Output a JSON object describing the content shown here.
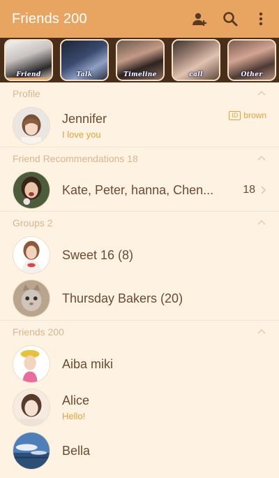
{
  "header": {
    "title": "Friends 200",
    "icons": [
      "add-friend-icon",
      "search-icon",
      "more-vert-icon"
    ],
    "colors": {
      "bar": "#e8a562",
      "strip": "#4a2e1c",
      "background": "#fef3e2",
      "accent": "#e3a13a"
    }
  },
  "tabs": [
    {
      "label": "Friend",
      "active": true
    },
    {
      "label": "Talk",
      "active": false
    },
    {
      "label": "Timeline",
      "active": false
    },
    {
      "label": "call",
      "active": false
    },
    {
      "label": "Other",
      "active": false
    }
  ],
  "profile": {
    "section_label": "Profile",
    "name": "Jennifer",
    "status": "I love you",
    "id_label": "ID",
    "id_value": "brown"
  },
  "recommendations": {
    "section_label": "Friend Recommendations 18",
    "names": "Kate, Peter, hanna, Chen...",
    "count": "18"
  },
  "groups": {
    "section_label": "Groups 2",
    "items": [
      {
        "name": "Sweet 16 (8)"
      },
      {
        "name": "Thursday Bakers (20)"
      }
    ]
  },
  "friends": {
    "section_label": "Friends 200",
    "items": [
      {
        "name": "Aiba miki",
        "status": ""
      },
      {
        "name": "Alice",
        "status": "Hello!"
      },
      {
        "name": "Bella",
        "status": ""
      }
    ]
  }
}
